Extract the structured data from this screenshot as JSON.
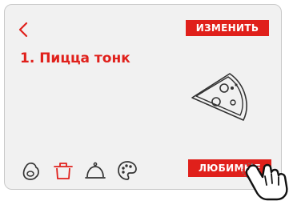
{
  "header": {
    "back_icon": "chevron-left-icon",
    "edit_label": "ИЗМЕНИТЬ"
  },
  "main": {
    "title": "1. Пицца тонк",
    "illustration_icon": "pizza-slice-icon"
  },
  "bottom_bar": {
    "icons": [
      "dough-icon",
      "pot-icon",
      "cloche-icon",
      "palette-icon"
    ],
    "favorite_label": "ЛЮБИМЫЕ"
  },
  "overlay": {
    "pointer_icon": "tapping-hand-icon"
  },
  "colors": {
    "accent": "#e0201b",
    "background": "#f1f1f1",
    "icon": "#333333"
  }
}
